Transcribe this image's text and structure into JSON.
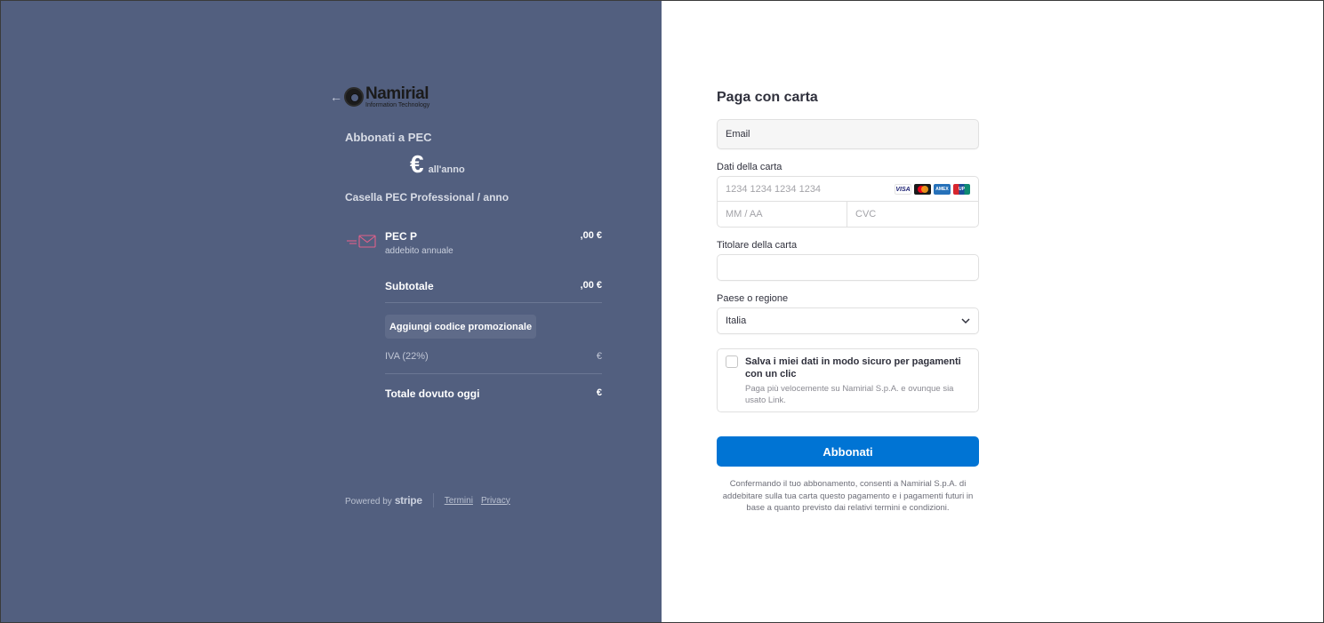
{
  "summary": {
    "back_icon": "arrow-left-icon",
    "logo_name": "Namirial",
    "logo_sub": "Information Technology",
    "product_name": "Abbonati a PEC",
    "price_symbol": "€",
    "price_period": "all'anno",
    "plan_name": "Casella PEC Professional / anno",
    "item": {
      "icon": "email-icon",
      "title": "PEC P",
      "subtitle": "addebito annuale",
      "price": ",00 €"
    },
    "subtotal_label": "Subtotale",
    "subtotal_value": ",00 €",
    "promo_label": "Aggiungi codice promozionale",
    "vat_label": "IVA (22%)",
    "vat_value": "€",
    "total_label": "Totale dovuto oggi",
    "total_value": "€"
  },
  "footer": {
    "powered_by": "Powered by",
    "stripe": "stripe",
    "terms": "Termini",
    "privacy": "Privacy"
  },
  "form": {
    "title": "Paga con carta",
    "email_placeholder": "Email",
    "card_label": "Dati della carta",
    "card_number_placeholder": "1234 1234 1234 1234",
    "card_brands": [
      "VISA",
      "",
      "AMEX",
      "UP"
    ],
    "expiry_placeholder": "MM / AA",
    "cvc_placeholder": "CVC",
    "holder_label": "Titolare della carta",
    "holder_value": "",
    "country_label": "Paese o regione",
    "country_value": "Italia",
    "save_title": "Salva i miei dati in modo sicuro per pagamenti con un clic",
    "save_subtitle": "Paga più velocemente su Namirial S.p.A. e ovunque sia usato Link.",
    "subscribe_label": "Abbonati",
    "legal_text": "Confermando il tuo abbonamento, consenti a Namirial S.p.A. di addebitare sulla tua carta questo pagamento e i pagamenti futuri in base a quanto previsto dai relativi termini e condizioni."
  },
  "colors": {
    "left_panel": "#525f7f",
    "button": "#0074d4",
    "accent_icon": "#e0608a"
  }
}
